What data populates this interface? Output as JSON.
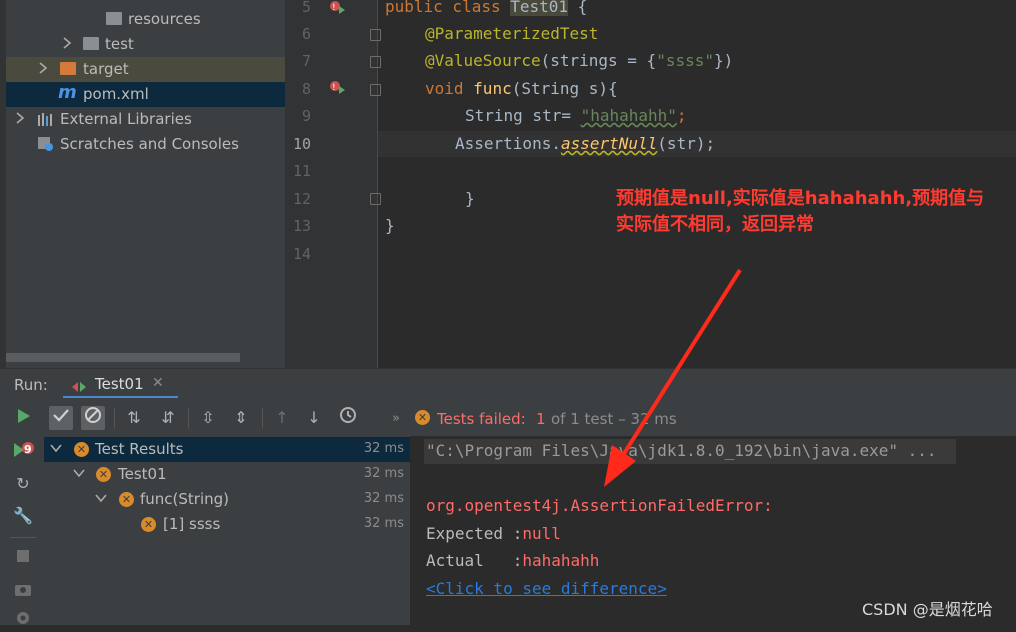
{
  "project_tree": {
    "items": [
      {
        "label": "resources",
        "expandable": false
      },
      {
        "label": "test",
        "expandable": true
      },
      {
        "label": "target",
        "expandable": true
      },
      {
        "label": "pom.xml",
        "expandable": false
      },
      {
        "label": "External Libraries",
        "expandable": true
      },
      {
        "label": "Scratches and Consoles",
        "expandable": false
      }
    ]
  },
  "editor": {
    "line_numbers": [
      "5",
      "6",
      "7",
      "8",
      "9",
      "10",
      "11",
      "12",
      "13",
      "14"
    ],
    "code": {
      "l5_a": "public class ",
      "l5_b": "Test01",
      "l5_c": " {",
      "l6": "@ParameterizedTest",
      "l7_a": "@ValueSource",
      "l7_b": "(strings = {",
      "l7_c": "\"ssss\"",
      "l7_d": "})",
      "l8_a": "void ",
      "l8_b": "func",
      "l8_c": "(String s){",
      "l9_a": "String str= ",
      "l9_b": "\"hahahahh\"",
      "l9_c": ";",
      "l10_a": "Assertions.",
      "l10_b": "assertNull",
      "l10_c": "(str);",
      "l12": "}",
      "l13": "}"
    }
  },
  "annotation": {
    "line1": "预期值是null,实际值是hahahahh,预期值与",
    "line2": "实际值不相同，返回异常"
  },
  "run_panel": {
    "label": "Run:",
    "tab_label": "Test01",
    "status_prefix": "Tests failed:",
    "status_count": "1",
    "status_suffix": "of 1 test – 32 ms",
    "sidebar_badge": "9"
  },
  "test_tree": {
    "rows": [
      {
        "label": "Test Results",
        "time": "32 ms"
      },
      {
        "label": "Test01",
        "time": "32 ms"
      },
      {
        "label": "func(String)",
        "time": "32 ms"
      },
      {
        "label": "[1] ssss",
        "time": "32 ms"
      }
    ]
  },
  "console": {
    "cmd": "\"C:\\Program Files\\Java\\jdk1.8.0_192\\bin\\java.exe\" ...",
    "error": "org.opentest4j.AssertionFailedError:",
    "expected_label": "Expected :",
    "expected_value": "null",
    "actual_label": "Actual   :",
    "actual_value": "hahahahh",
    "link": "<Click to see difference>"
  },
  "watermark": "CSDN @是烟花哈",
  "colors": {
    "error": "#ff6b68",
    "fail_icon": "#d98a2b",
    "run_green": "#59a869"
  }
}
